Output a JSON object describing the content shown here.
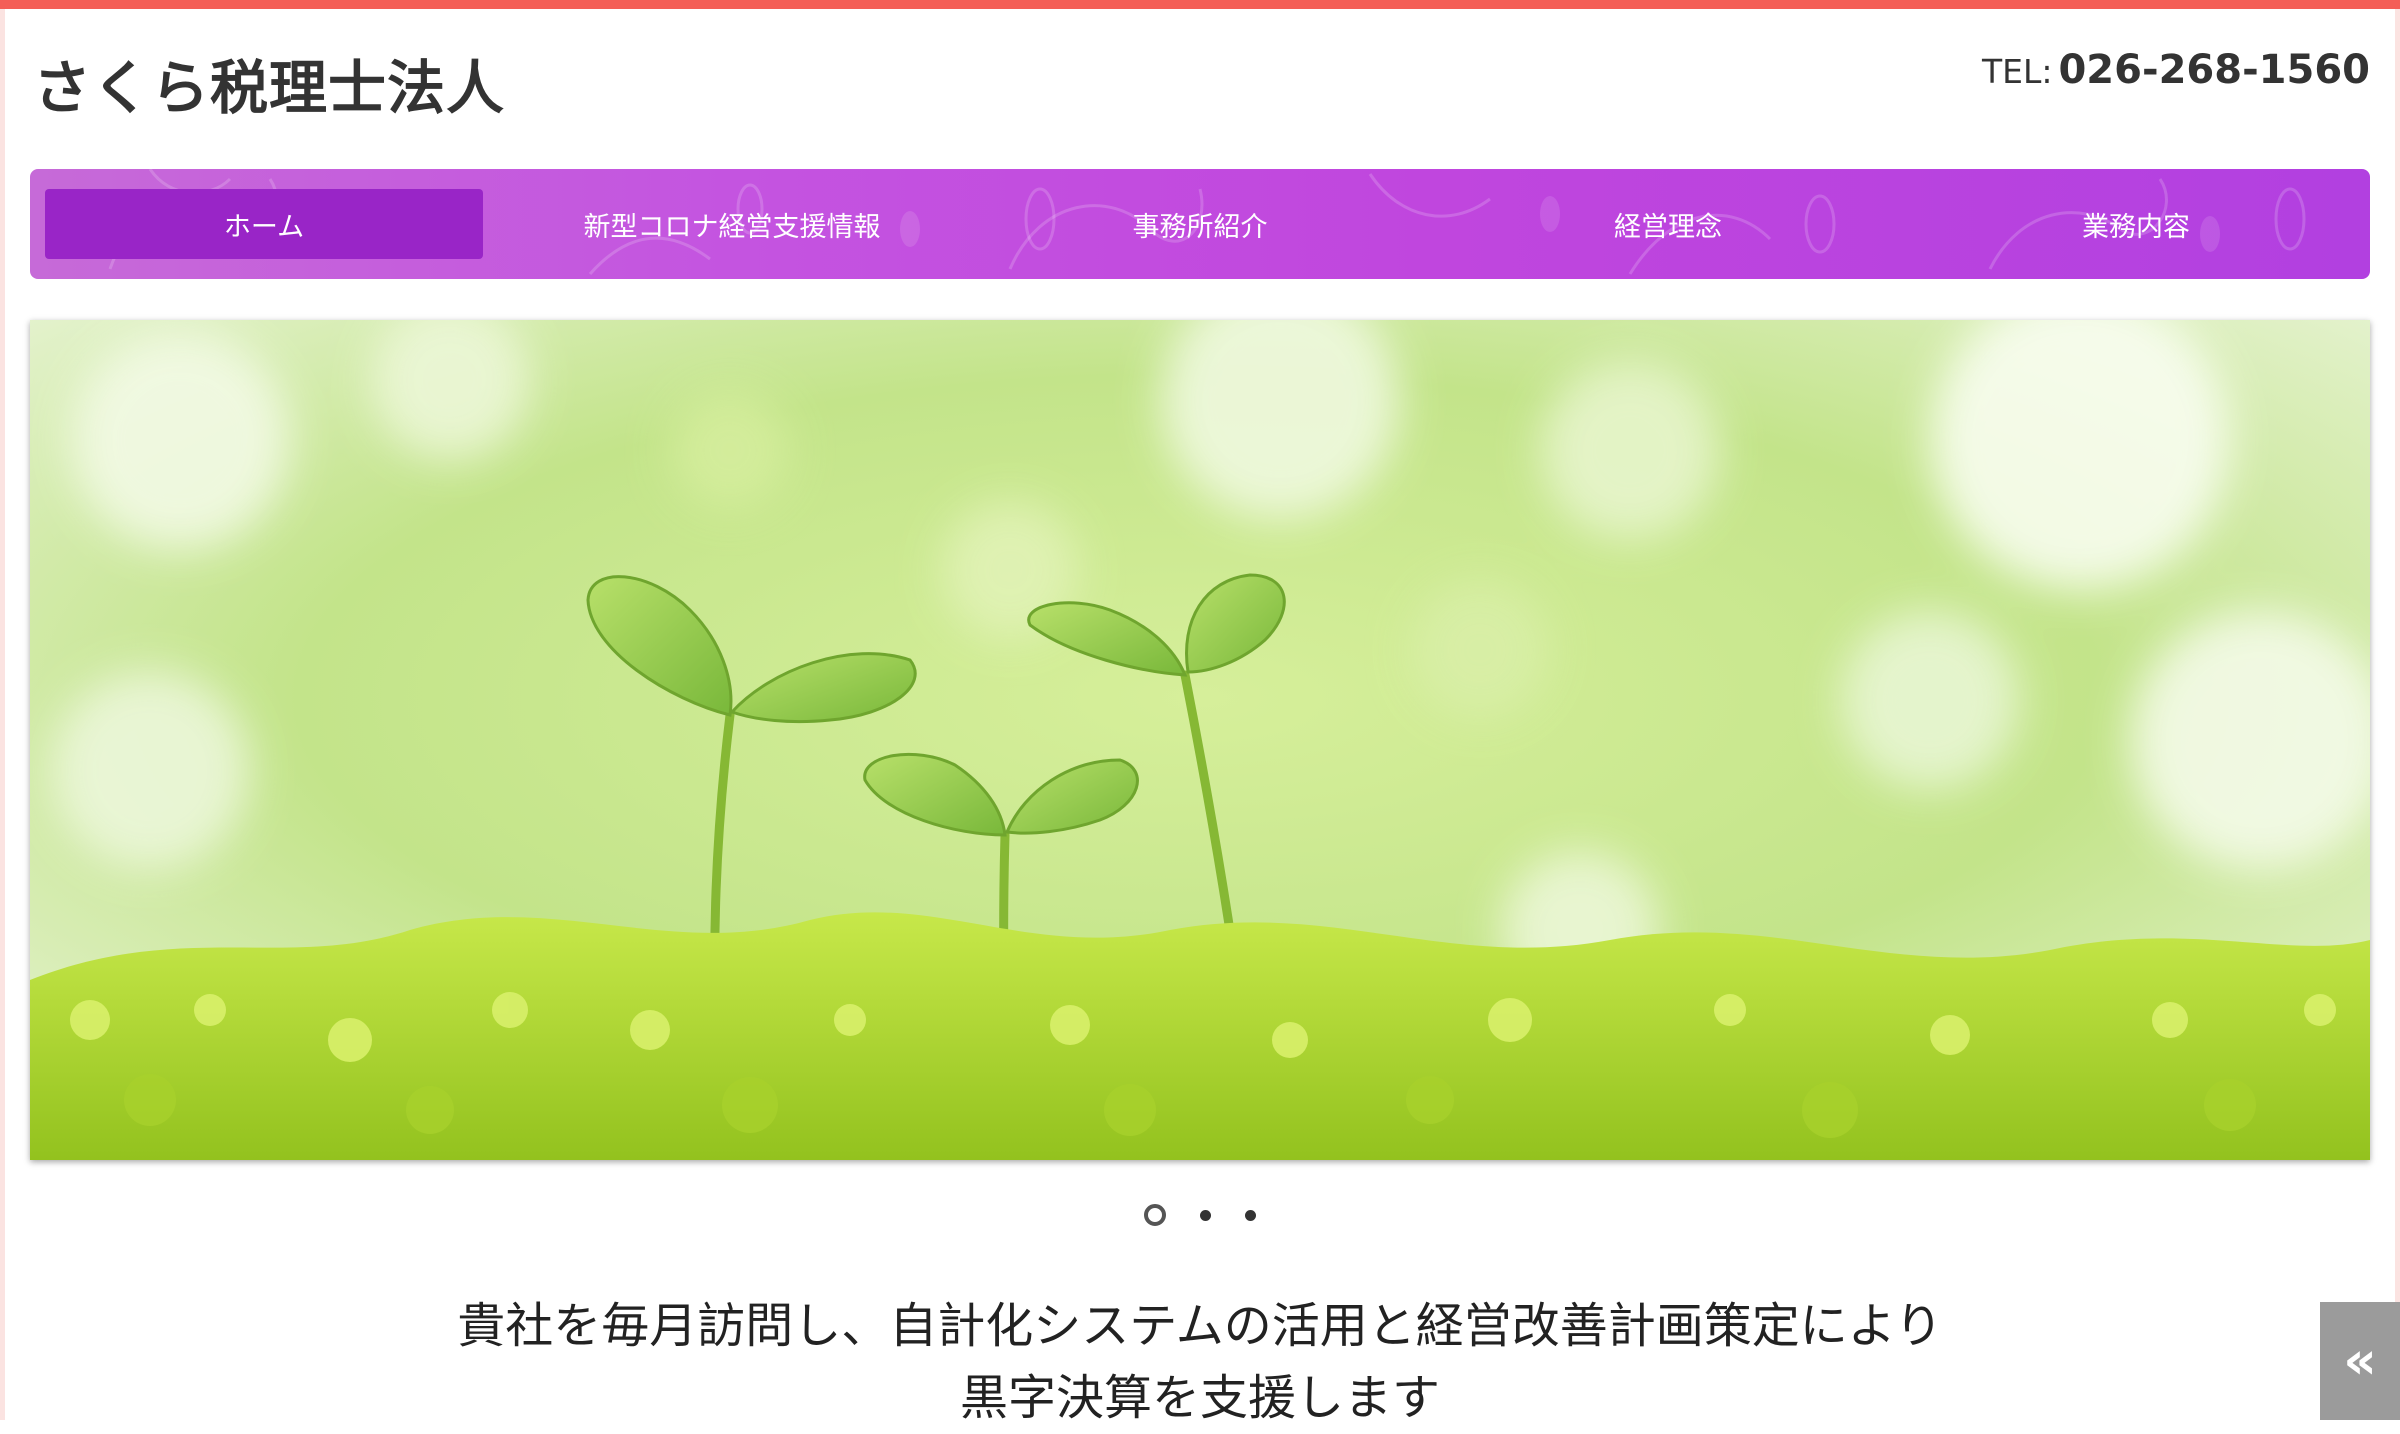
{
  "header": {
    "site_title": "さくら税理士法人",
    "tel_label": "TEL:",
    "tel_number": "026-268-1560"
  },
  "nav": {
    "items": [
      {
        "label": "ホーム",
        "active": true
      },
      {
        "label": "新型コロナ経営支援情報",
        "active": false
      },
      {
        "label": "事務所紹介",
        "active": false
      },
      {
        "label": "経営理念",
        "active": false
      },
      {
        "label": "業務内容",
        "active": false
      }
    ]
  },
  "hero": {
    "image": "green-sprouts-on-moss"
  },
  "carousel": {
    "slide_count": 3,
    "active_index": 0
  },
  "main": {
    "tagline_line1": "貴社を毎月訪問し、自計化システムの活用と経営改善計画策定により",
    "tagline_line2": "黒字決算を支援します"
  },
  "widgets": {
    "back_to_top_glyph": "«"
  },
  "colors": {
    "accent_top_bar": "#f45e57",
    "nav_background": "#c046de",
    "nav_active": "#9925c7"
  }
}
